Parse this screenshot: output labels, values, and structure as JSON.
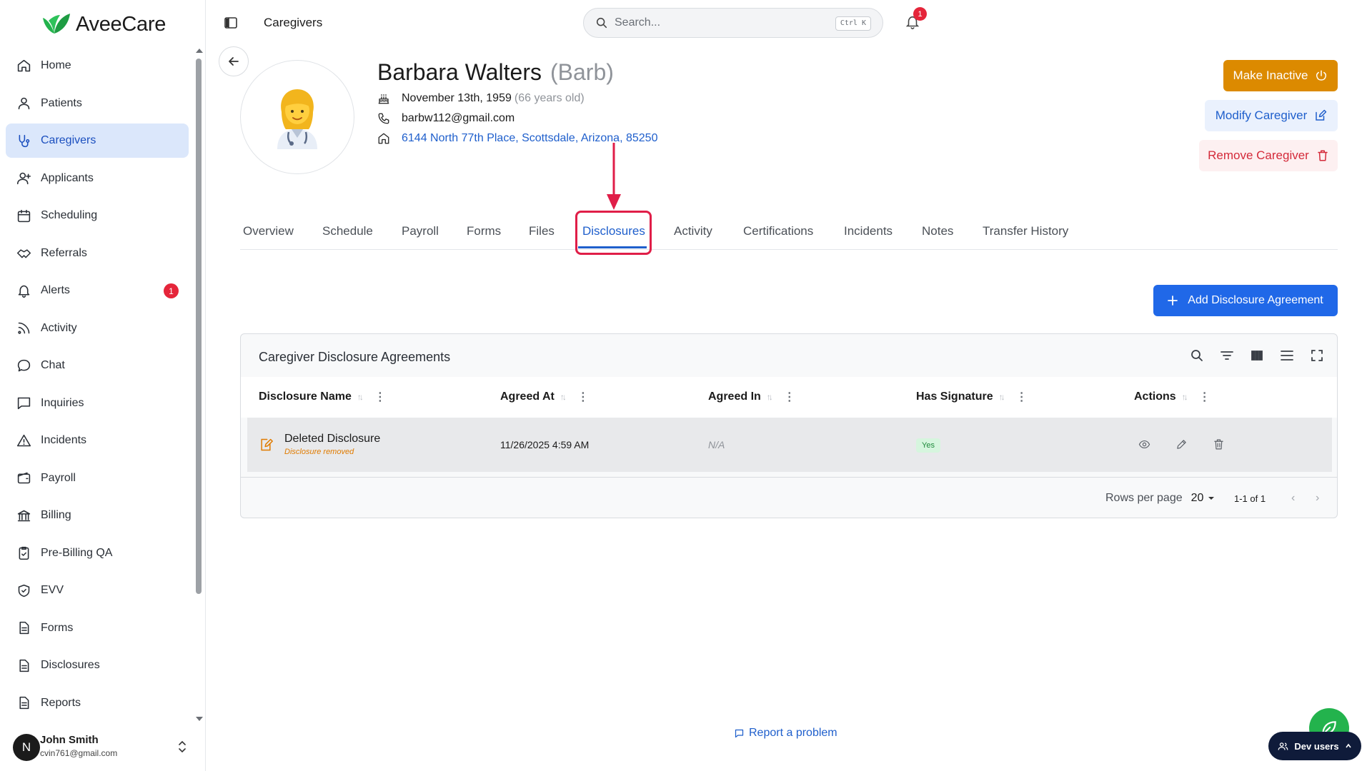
{
  "app": {
    "logo_text": "AveeCare",
    "brand_color": "#23b34d"
  },
  "sidebar": {
    "items": [
      {
        "label": "Home",
        "icon": "home-icon"
      },
      {
        "label": "Patients",
        "icon": "user-icon"
      },
      {
        "label": "Caregivers",
        "icon": "stethoscope-icon",
        "active": true
      },
      {
        "label": "Applicants",
        "icon": "user-plus-icon"
      },
      {
        "label": "Scheduling",
        "icon": "calendar-icon"
      },
      {
        "label": "Referrals",
        "icon": "handshake-icon"
      },
      {
        "label": "Alerts",
        "icon": "bell-icon",
        "badge": "1"
      },
      {
        "label": "Activity",
        "icon": "rss-icon"
      },
      {
        "label": "Chat",
        "icon": "chat-icon"
      },
      {
        "label": "Inquiries",
        "icon": "message-square-icon"
      },
      {
        "label": "Incidents",
        "icon": "warning-icon"
      },
      {
        "label": "Payroll",
        "icon": "wallet-icon"
      },
      {
        "label": "Billing",
        "icon": "bank-icon"
      },
      {
        "label": "Pre-Billing QA",
        "icon": "clipboard-check-icon"
      },
      {
        "label": "EVV",
        "icon": "shield-check-icon"
      },
      {
        "label": "Forms",
        "icon": "file-text-icon"
      },
      {
        "label": "Disclosures",
        "icon": "file-text-icon"
      },
      {
        "label": "Reports",
        "icon": "file-text-icon"
      }
    ],
    "user": {
      "initial": "N",
      "name": "John Smith",
      "email": "cvin761@gmail.com"
    }
  },
  "topbar": {
    "title": "Caregivers",
    "search_placeholder": "Search...",
    "search_shortcut": "Ctrl K",
    "notification_count": "1"
  },
  "profile": {
    "name": "Barbara Walters",
    "nickname": "(Barb)",
    "birthday": "November 13th, 1959",
    "age": "(66 years old)",
    "email": "barbw112@gmail.com",
    "address": "6144 North 77th Place, Scottsdale, Arizona, 85250"
  },
  "actions": {
    "make_inactive": "Make Inactive",
    "modify": "Modify Caregiver",
    "remove": "Remove Caregiver",
    "add_disclosure": "Add Disclosure Agreement"
  },
  "tabs": [
    {
      "label": "Overview"
    },
    {
      "label": "Schedule"
    },
    {
      "label": "Payroll"
    },
    {
      "label": "Forms"
    },
    {
      "label": "Files"
    },
    {
      "label": "Disclosures",
      "active": true
    },
    {
      "label": "Activity"
    },
    {
      "label": "Certifications"
    },
    {
      "label": "Incidents"
    },
    {
      "label": "Notes"
    },
    {
      "label": "Transfer History"
    }
  ],
  "table": {
    "title": "Caregiver Disclosure Agreements",
    "columns": [
      "Disclosure Name",
      "Agreed At",
      "Agreed In",
      "Has Signature",
      "Actions"
    ],
    "rows": [
      {
        "name": "Deleted Disclosure",
        "subtitle": "Disclosure removed",
        "agreed_at": "11/26/2025 4:59 AM",
        "agreed_in": "N/A",
        "has_signature": "Yes"
      }
    ],
    "rows_per_page_label": "Rows per page",
    "rows_per_page": "20",
    "pagination": "1-1 of 1"
  },
  "footer": {
    "report_problem": "Report a problem",
    "dev_users": "Dev users"
  }
}
